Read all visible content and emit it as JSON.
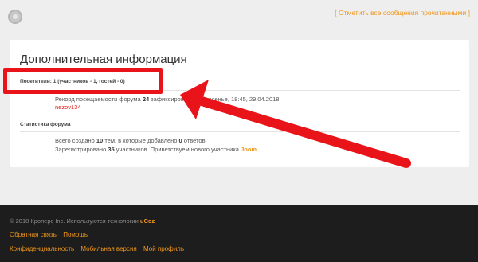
{
  "top": {
    "bracket_open": "[ ",
    "mark_all_read": "Отметить все сообщения прочитанными",
    "bracket_close": " ]"
  },
  "info": {
    "title": "Дополнительная информация",
    "visitors": "Посетители: 1  (участников - 1, гостей - 0)",
    "record_prefix": "Рекорд посещаемости форума ",
    "record_count": "24",
    "record_suffix": " зафиксирован Воскресенье, 18:45, 29.04.2018.",
    "online_user": "nezov134",
    "stats_label": "Статистика форума",
    "stats_line1_a": "Всего создано ",
    "stats_topics": "10",
    "stats_line1_b": " тем, в которые добавлено ",
    "stats_answers": "0",
    "stats_line1_c": " ответов.",
    "stats_line2_a": "Зарегистрировано ",
    "stats_members": "35",
    "stats_line2_b": " участников. Приветствуем нового участника ",
    "stats_new_member": "Joom",
    "stats_line2_end": "."
  },
  "footer": {
    "copyright": "© 2018 Кроперс Inc. Используются технологии ",
    "tech": "uCoz",
    "links_row1": [
      "Обратная связь",
      "Помощь"
    ],
    "links_row2": [
      "Конфиденциальность",
      "Мобильная версия",
      "Мой профиль"
    ]
  },
  "colors": {
    "accent": "#f0961a",
    "annotation_red": "#e8141a",
    "footer_bg": "#1d1d1d"
  }
}
